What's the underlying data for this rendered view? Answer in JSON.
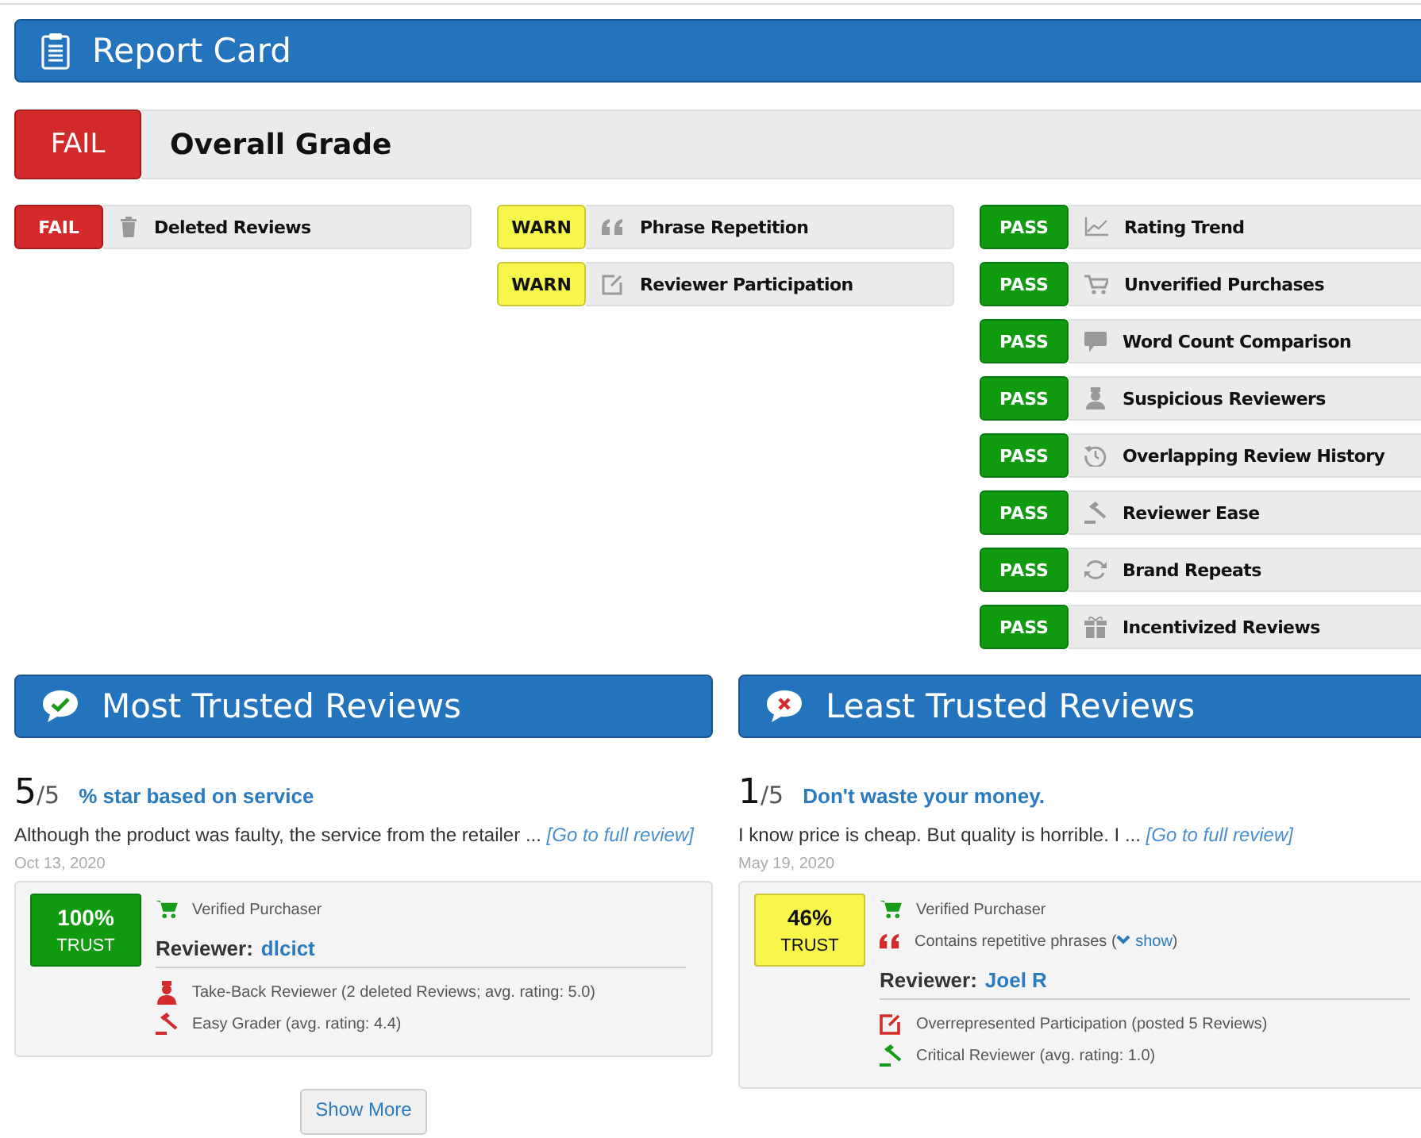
{
  "header": {
    "title": "Report Card"
  },
  "overall": {
    "kind": "fail",
    "badge": "FAIL",
    "label": "Overall Grade"
  },
  "check_columns": [
    [
      {
        "kind": "fail",
        "badge": "FAIL",
        "label": "Deleted Reviews"
      }
    ],
    [
      {
        "kind": "warn",
        "badge": "WARN",
        "label": "Phrase Repetition"
      },
      {
        "kind": "warn",
        "badge": "WARN",
        "label": "Reviewer Participation"
      }
    ],
    [
      {
        "kind": "pass",
        "badge": "PASS",
        "label": "Rating Trend"
      },
      {
        "kind": "pass",
        "badge": "PASS",
        "label": "Unverified Purchases"
      },
      {
        "kind": "pass",
        "badge": "PASS",
        "label": "Word Count Comparison"
      },
      {
        "kind": "pass",
        "badge": "PASS",
        "label": "Suspicious Reviewers"
      },
      {
        "kind": "pass",
        "badge": "PASS",
        "label": "Overlapping Review History"
      },
      {
        "kind": "pass",
        "badge": "PASS",
        "label": "Reviewer Ease"
      },
      {
        "kind": "pass",
        "badge": "PASS",
        "label": "Brand Repeats"
      },
      {
        "kind": "pass",
        "badge": "PASS",
        "label": "Incentivized Reviews"
      }
    ]
  ],
  "sections": [
    {
      "kind": "trusted",
      "title": "Most Trusted Reviews",
      "review": {
        "score": "5",
        "out_of": "/5",
        "headline": "% star based on service",
        "excerpt": "Although the product was faulty, the service from the retailer ... ",
        "full_link": "[Go to full review]",
        "date": "Oct 13, 2020",
        "trust": {
          "kind": "pass",
          "percent": "100%",
          "label": "TRUST"
        },
        "flags": [
          {
            "kind": "verified",
            "text": "Verified Purchaser"
          }
        ],
        "reviewer_label": "Reviewer:",
        "reviewer": "dlcict",
        "reviewer_flags": [
          {
            "kind": "takeback",
            "text": "Take-Back Reviewer (2 deleted Reviews; avg. rating: 5.0)"
          },
          {
            "kind": "easy",
            "text": "Easy Grader (avg. rating: 4.4)"
          }
        ]
      },
      "show_more": "Show More"
    },
    {
      "kind": "untrusted",
      "title": "Least Trusted Reviews",
      "review": {
        "score": "1",
        "out_of": "/5",
        "headline": "Don't waste your money.",
        "excerpt": "I know price is cheap. But quality is horrible. I ... ",
        "full_link": "[Go to full review]",
        "date": "May 19, 2020",
        "trust": {
          "kind": "warn",
          "percent": "46%",
          "label": "TRUST"
        },
        "flags": [
          {
            "kind": "verified",
            "text": "Verified Purchaser"
          },
          {
            "kind": "phrases",
            "text": "Contains repetitive phrases (",
            "link": "show",
            "text_after": ")"
          }
        ],
        "reviewer_label": "Reviewer:",
        "reviewer": "Joel R",
        "reviewer_flags": [
          {
            "kind": "overrep",
            "text": "Overrepresented Participation (posted 5 Reviews)"
          },
          {
            "kind": "critical",
            "text": "Critical Reviewer (avg. rating: 1.0)"
          }
        ]
      }
    }
  ]
}
